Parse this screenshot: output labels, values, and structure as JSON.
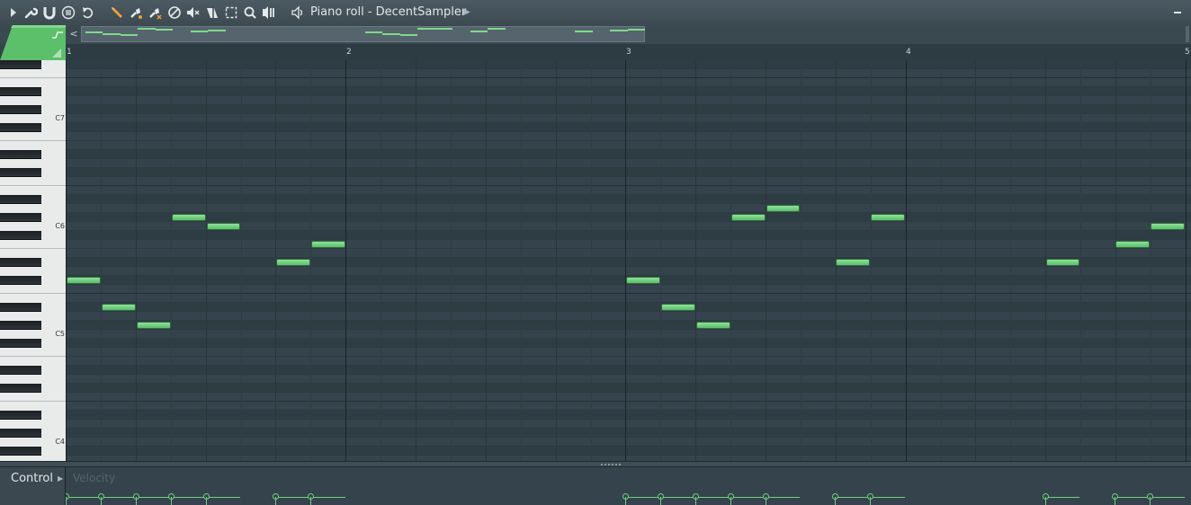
{
  "window": {
    "title": "Piano roll - DecentSampler"
  },
  "toolbar": {
    "icons": [
      "play-arrow-icon",
      "wrench-icon",
      "magnet-icon",
      "menu-circle-icon",
      "undo-icon",
      "pencil-icon",
      "paint-brush-icon",
      "delete-brush-icon",
      "mute-slash-icon",
      "mute-speaker-icon",
      "slice-icon",
      "select-icon",
      "zoom-icon",
      "playback-icon",
      "speaker-icon"
    ]
  },
  "ruler": {
    "bars": [
      "1",
      "2",
      "3",
      "4",
      "5"
    ]
  },
  "keyboard": {
    "octaves": [
      "C7",
      "C6",
      "C5",
      "C4"
    ]
  },
  "control": {
    "label": "Control",
    "target": "Velocity"
  },
  "colors": {
    "note_fill": "#7ad387",
    "grid_bg": "#34434c",
    "accent": "#6fd080"
  },
  "notes": [
    {
      "bar": 1,
      "step": 0,
      "length": 1,
      "pitch": "C#5"
    },
    {
      "bar": 1,
      "step": 1,
      "length": 1,
      "pitch": "A#4"
    },
    {
      "bar": 1,
      "step": 2,
      "length": 1,
      "pitch": "G#4"
    },
    {
      "bar": 1,
      "step": 3,
      "length": 1,
      "pitch": "G#5"
    },
    {
      "bar": 1,
      "step": 4,
      "length": 1,
      "pitch": "G5"
    },
    {
      "bar": 1,
      "step": 6,
      "length": 1,
      "pitch": "D#5"
    },
    {
      "bar": 1,
      "step": 7,
      "length": 1,
      "pitch": "F5"
    },
    {
      "bar": 3,
      "step": 0,
      "length": 1,
      "pitch": "C#5"
    },
    {
      "bar": 3,
      "step": 1,
      "length": 1,
      "pitch": "A#4"
    },
    {
      "bar": 3,
      "step": 2,
      "length": 1,
      "pitch": "G#4"
    },
    {
      "bar": 3,
      "step": 3,
      "length": 1,
      "pitch": "G#5"
    },
    {
      "bar": 3,
      "step": 4,
      "length": 1,
      "pitch": "A5"
    },
    {
      "bar": 3,
      "step": 6,
      "length": 1,
      "pitch": "D#5"
    },
    {
      "bar": 3,
      "step": 7,
      "length": 1,
      "pitch": "G#5"
    },
    {
      "bar": 4,
      "step": 4,
      "length": 1,
      "pitch": "D#5"
    },
    {
      "bar": 4,
      "step": 6,
      "length": 1,
      "pitch": "F5"
    },
    {
      "bar": 4,
      "step": 7,
      "length": 1,
      "pitch": "G5"
    }
  ]
}
